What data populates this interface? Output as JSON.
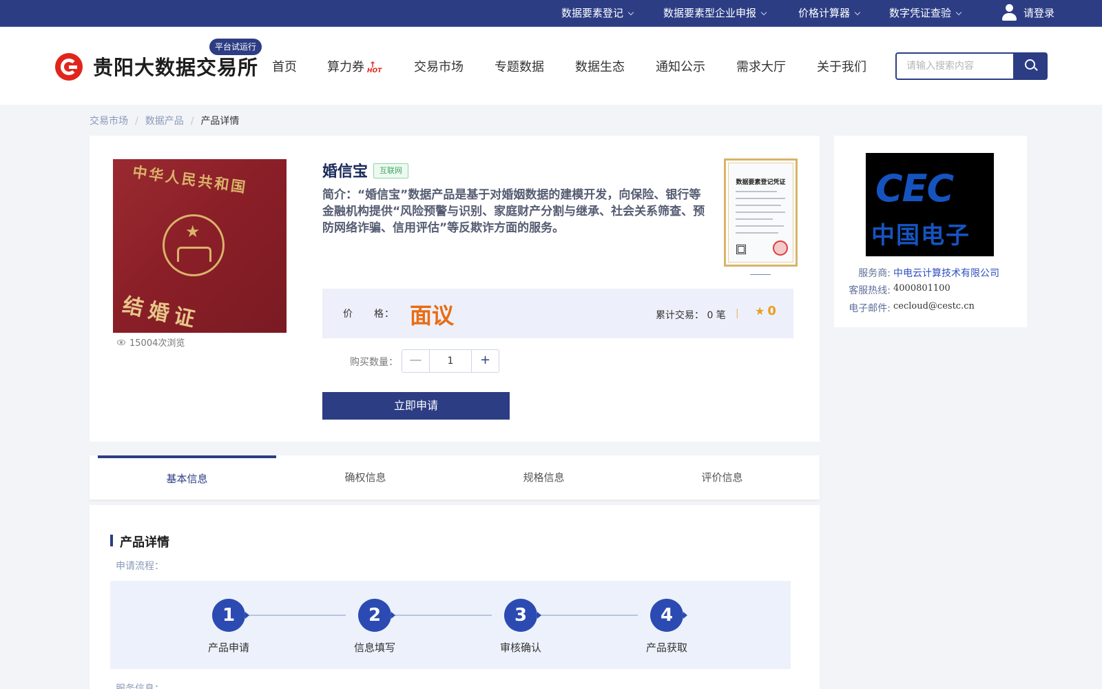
{
  "topbar": {
    "items": [
      "数据要素登记",
      "数据要素型企业申报",
      "价格计算器",
      "数字凭证查验"
    ],
    "login": "请登录"
  },
  "header": {
    "logo_text": "贵阳大数据交易所",
    "trial_badge": "平台试运行",
    "nav": [
      "首页",
      "算力券",
      "交易市场",
      "专题数据",
      "数据生态",
      "通知公示",
      "需求大厅",
      "关于我们"
    ],
    "hot_tag": "HOT",
    "search_placeholder": "请输入搜索内容"
  },
  "breadcrumb": [
    "交易市场",
    "数据产品",
    "产品详情"
  ],
  "breadcrumb_sep": "/",
  "product": {
    "image_text_top": "中华人民共和国",
    "image_text_bottom": "结婚证",
    "views": "15004次浏览",
    "title": "婚信宝",
    "category": "互联网",
    "summary": "简介：“婚信宝”数据产品是基于对婚姻数据的建模开发，向保险、银行等金融机构提供“风险预警与识别、家庭财产分割与继承、社会关系筛查、预防网络诈骗、信用评估”等反欺诈方面的服务。",
    "certificate_title": "数据要素登记凭证",
    "price_label": "价　　格：",
    "price": "面议",
    "deals": "累计交易：  0 笔",
    "pipe": "|",
    "rating": "0",
    "qty_label": "购买数量：",
    "qty_minus": "—",
    "qty_value": "1",
    "qty_plus": "+",
    "apply_button": "立即申请"
  },
  "provider": {
    "logo_top": "CEC",
    "logo_bottom": "中国电子",
    "rows": [
      {
        "label": "服务商:",
        "value": "中电云计算技术有限公司"
      },
      {
        "label": "客服热线:",
        "value": "4000801100"
      },
      {
        "label": "电子邮件:",
        "value": "cecloud@cestc.cn"
      }
    ]
  },
  "tabs": [
    "基本信息",
    "确权信息",
    "规格信息",
    "评价信息"
  ],
  "detail": {
    "title": "产品详情",
    "process_label": "申请流程：",
    "steps": [
      {
        "num": "1",
        "label": "产品申请"
      },
      {
        "num": "2",
        "label": "信息填写"
      },
      {
        "num": "3",
        "label": "审核确认"
      },
      {
        "num": "4",
        "label": "产品获取"
      }
    ],
    "service_label": "服务信息："
  },
  "colors": {
    "primary": "#2c3d84",
    "price": "#ea6b12",
    "logo_red": "#e1251b",
    "rating": "#ea9d22"
  }
}
